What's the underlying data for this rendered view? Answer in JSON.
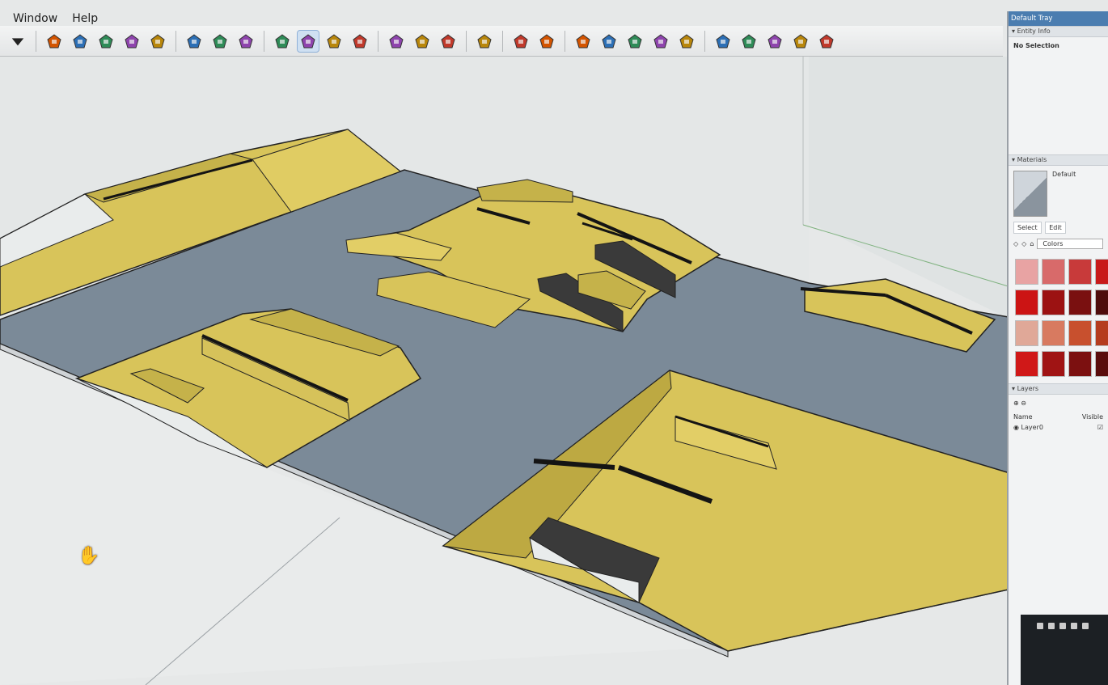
{
  "menu": {
    "items": [
      "Window",
      "Help"
    ]
  },
  "toolbar": {
    "groups": [
      [
        "dropdown-icon"
      ],
      [
        "push-pull-icon",
        "follow-me-icon",
        "move-icon",
        "rotate-icon",
        "scale-icon"
      ],
      [
        "tape-measure-icon",
        "text-icon",
        "paint-bucket-icon"
      ],
      [
        "orbit-icon",
        "pan-icon",
        "zoom-icon",
        "zoom-extents-icon"
      ],
      [
        "warehouse-icon",
        "share-model-icon",
        "extension-warehouse-icon"
      ],
      [
        "ruby-icon"
      ],
      [
        "sandbox-smoove-icon",
        "sandbox-grid-icon"
      ],
      [
        "solid-union-icon",
        "solid-intersect-icon",
        "solid-shell-icon",
        "solid-trim-icon",
        "solid-split-icon"
      ],
      [
        "iso-view-icon",
        "top-view-icon",
        "front-view-icon",
        "right-view-icon",
        "back-view-icon"
      ]
    ],
    "active_icon": "pan-icon"
  },
  "tray": {
    "title": "Default Tray",
    "entity_info": {
      "header": "Entity Info",
      "selection": "No Selection"
    },
    "materials": {
      "header": "Materials",
      "current": "Default",
      "tabs": [
        "Select",
        "Edit"
      ],
      "library": "Colors",
      "swatches": [
        "#e8a3a3",
        "#d86a6a",
        "#c83a3a",
        "#c81a1a",
        "#cc1414",
        "#9c1212",
        "#7a1010",
        "#4e0c0c",
        "#e0a898",
        "#d87a60",
        "#c8502e",
        "#b53c1e",
        "#d01818",
        "#a01414",
        "#7c1010",
        "#5a0c0c"
      ]
    },
    "layers": {
      "header": "Layers",
      "col_name": "Name",
      "col_visible": "Visible",
      "rows": [
        {
          "name": "Layer0",
          "visible": true
        }
      ]
    }
  },
  "colors": {
    "ground": "#7b8a98",
    "ramp_top": "#d8c45a",
    "ramp_side": "#b8a63e",
    "rail": "#141414",
    "box_top": "#4a4a4a",
    "sky": "#e6e8e8"
  }
}
